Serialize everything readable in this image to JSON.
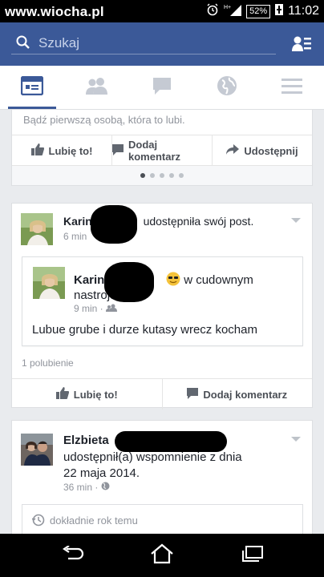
{
  "status_bar": {
    "watermark": "www.wiocha.pl",
    "battery": "52%",
    "time": "11:02"
  },
  "search": {
    "placeholder": "Szukaj"
  },
  "nav": {
    "items": [
      "news-feed",
      "friends",
      "messages",
      "notifications",
      "menu"
    ]
  },
  "post1": {
    "likes_prompt": "Bądź pierwszą osobą, która to lubi.",
    "like_label": "Lubię to!",
    "comment_label": "Dodaj komentarz",
    "share_label": "Udostępnij"
  },
  "post2": {
    "author": "Karin",
    "action": "udostępniła swój post.",
    "time": "6 min",
    "inner": {
      "author": "Karina",
      "activity": "w cudownym",
      "activity2": "nastroju",
      "time": "9 min ·",
      "text": "Lubue grube i durze kutasy wrecz kocham"
    },
    "likes_count": "1 polubienie",
    "like_label": "Lubię to!",
    "comment_label": "Dodaj komentarz"
  },
  "post3": {
    "author": "Elzbieta",
    "line1": "udostępnił(a) wspomnienie z dnia",
    "line2": "22 maja 2014.",
    "time": "36 min ·",
    "memory_label": "dokładnie rok temu"
  }
}
